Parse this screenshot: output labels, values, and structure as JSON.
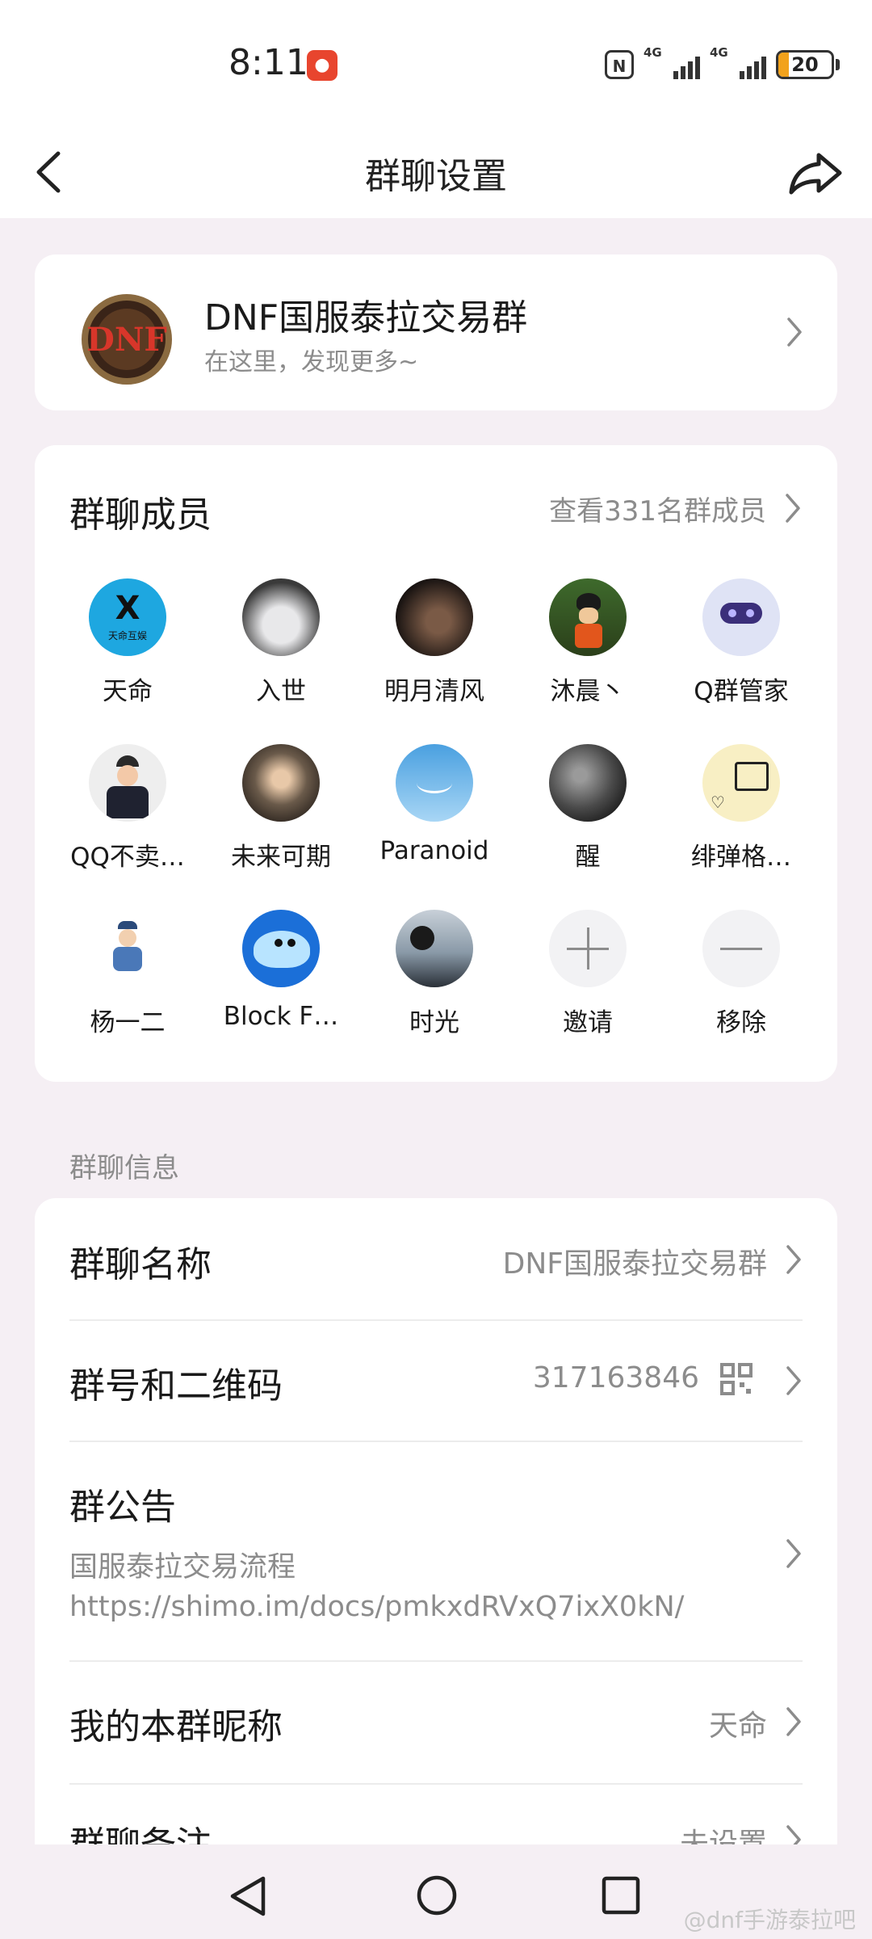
{
  "status_bar": {
    "time": "8:11",
    "battery": "20",
    "battery_level": 0.2,
    "net1": "4G",
    "net2": "4G",
    "nfc": "N"
  },
  "header": {
    "title": "群聊设置"
  },
  "group": {
    "name": "DNF国服泰拉交易群",
    "subtitle": "在这里，发现更多~",
    "logo_text": "DNF"
  },
  "members": {
    "title": "群聊成员",
    "view_all": "查看331名群成员",
    "list": [
      {
        "name": "天命",
        "avatar_text": "天命互娱"
      },
      {
        "name": "入世"
      },
      {
        "name": "明月清风"
      },
      {
        "name": "沐晨丶"
      },
      {
        "name": "Q群管家"
      },
      {
        "name": "QQ不卖…"
      },
      {
        "name": "未来可期"
      },
      {
        "name": "Paranoid"
      },
      {
        "name": "醒"
      },
      {
        "name": "绯弹格…"
      },
      {
        "name": "杨一二"
      },
      {
        "name": "Block F…"
      },
      {
        "name": "时光"
      }
    ],
    "invite": "邀请",
    "remove": "移除"
  },
  "info_section": {
    "label": "群聊信息",
    "name_label": "群聊名称",
    "name_value": "DNF国服泰拉交易群",
    "number_label": "群号和二维码",
    "number_value": "317163846",
    "announcement_label": "群公告",
    "announcement_line1": "国服泰拉交易流程",
    "announcement_line2": "https://shimo.im/docs/pmkxdRVxQ7ixX0kN/",
    "nickname_label": "我的本群昵称",
    "nickname_value": "天命",
    "remark_label": "群聊备注",
    "remark_value": "未设置"
  },
  "watermark": "@dnf手游泰拉吧",
  "colors": {
    "bg": "#f5eff4",
    "card": "#ffffff",
    "secondary": "#8c8c8c",
    "battery": "#f2a21c"
  }
}
